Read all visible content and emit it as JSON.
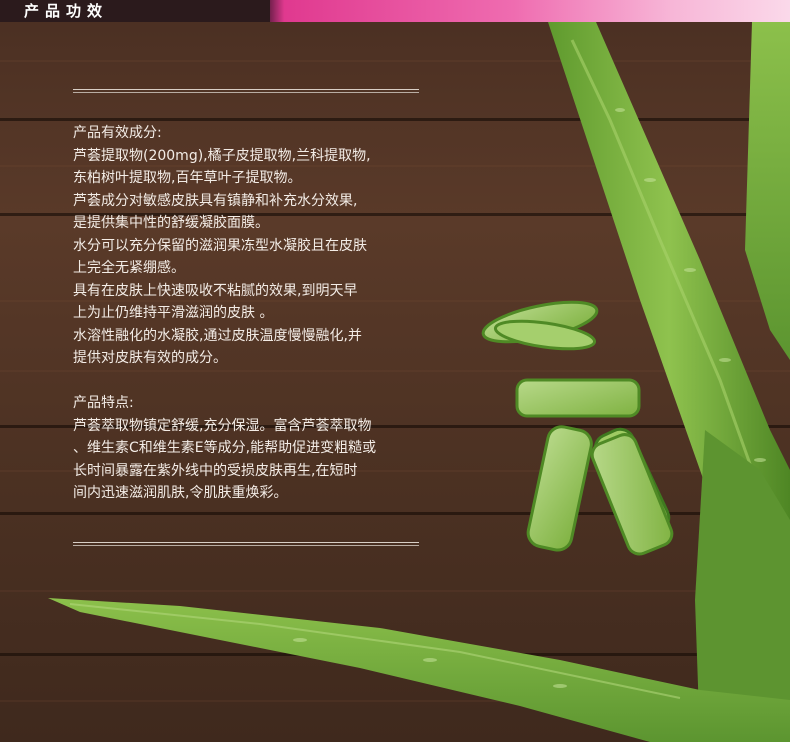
{
  "header": {
    "title": "产品功效"
  },
  "section1": {
    "heading": "产品有效成分:",
    "lines": [
      "芦荟提取物(200mg),橘子皮提取物,兰科提取物,",
      "东柏树叶提取物,百年草叶子提取物。",
      "芦荟成分对敏感皮肤具有镇静和补充水分效果,",
      "是提供集中性的舒缓凝胶面膜。",
      "水分可以充分保留的滋润果冻型水凝胶且在皮肤",
      "上完全无紧绷感。",
      "具有在皮肤上快速吸收不粘腻的效果,到明天早",
      "上为止仍维持平滑滋润的皮肤 。",
      "水溶性融化的水凝胶,通过皮肤温度慢慢融化,并",
      "提供对皮肤有效的成分。"
    ]
  },
  "section2": {
    "heading": "产品特点:",
    "lines": [
      "芦荟萃取物镇定舒缓,充分保湿。富含芦荟萃取物",
      "、维生素C和维生素E等成分,能帮助促进变粗糙或",
      "长时间暴露在紫外线中的受损皮肤再生,在短时",
      "间内迅速滋润肌肤,令肌肤重焕彩。"
    ]
  },
  "colors": {
    "wood": "#4a2f22",
    "text": "#f3ece6",
    "accent_pink": "#e0398f",
    "aloe_green": "#7fb241"
  },
  "images": {
    "background": "dark wood planks with aloe vera leaves and cut aloe pieces"
  }
}
